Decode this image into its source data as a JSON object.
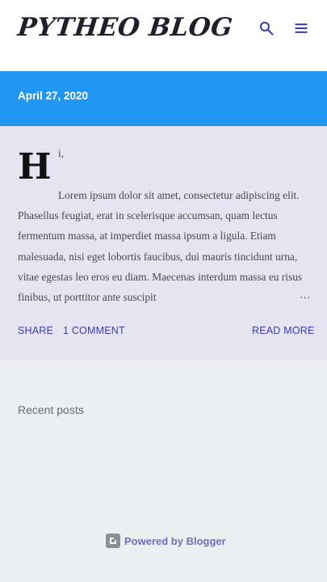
{
  "header": {
    "blog_title": "PYTHEO BLOG",
    "search_icon": "search-icon",
    "menu_icon": "hamburger-menu-icon"
  },
  "post": {
    "date": "April 27, 2020",
    "drop_cap": "H",
    "first_text": "i,",
    "snippet": "Lorem ipsum dolor sit amet, consectetur adipiscing elit. Phasellus feugiat, erat in scelerisque accumsan, quam lectus fermentum massa, at imperdiet massa ipsum a ligula. Etiam malesuada, nisi eget lobortis faucibus, dui mauris tincidunt urna, vitae egestas leo eros eu diam. Maecenas interdum massa eu risus finibus, ut porttitor ante suscipit",
    "ellipsis": "…",
    "share_label": "SHARE",
    "comments_label": "1 COMMENT",
    "read_more_label": "READ MORE"
  },
  "sidebar": {
    "recent_posts_label": "Recent posts"
  },
  "footer": {
    "powered_by": "Powered by Blogger",
    "blogger_icon": "blogger-logo-icon"
  },
  "colors": {
    "date_band": "#2196f3",
    "post_card": "#e7e4f1",
    "page_background": "#eceff1",
    "link_accent": "#3b3bb5"
  }
}
